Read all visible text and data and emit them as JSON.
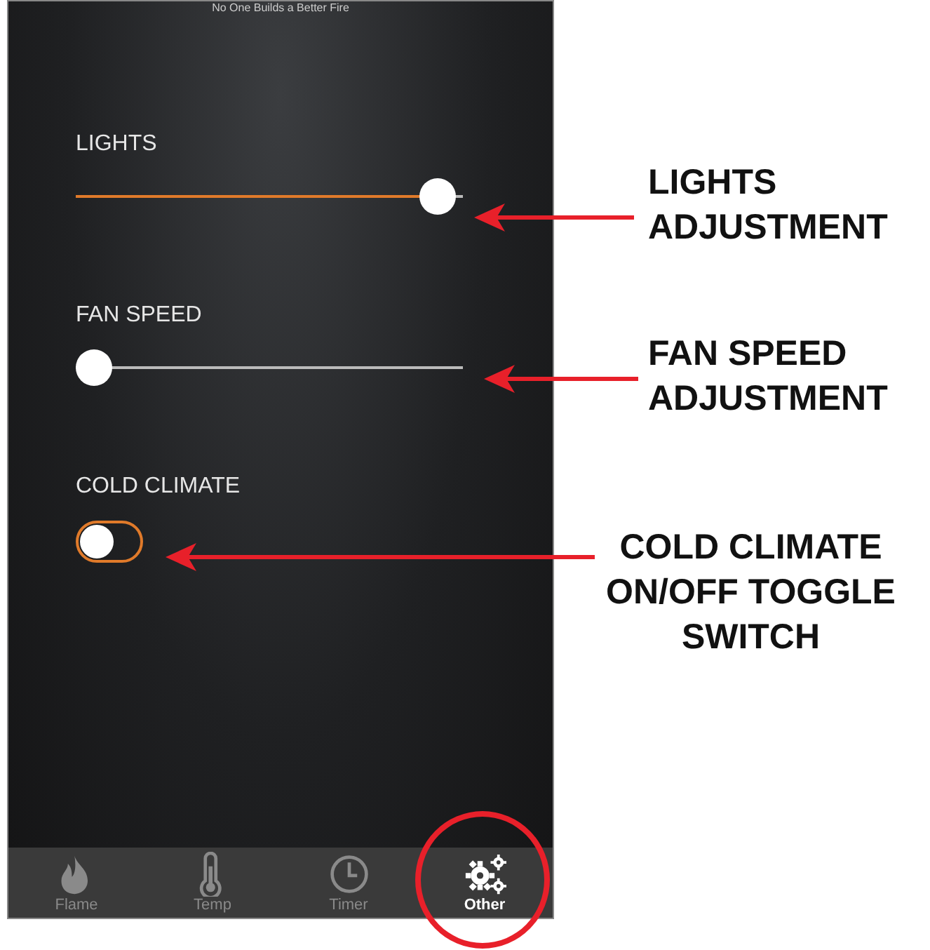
{
  "screen": {
    "tagline": "No One Builds a Better Fire",
    "settings": [
      {
        "kind": "slider",
        "label": "LIGHTS",
        "level": 0.98
      },
      {
        "kind": "slider",
        "label": "FAN SPEED",
        "level": 0
      },
      {
        "kind": "toggle",
        "label": "COLD CLIMATE",
        "on": false
      }
    ],
    "tabs": [
      {
        "label": "Flame",
        "selected": false,
        "circled": false
      },
      {
        "label": "Temp",
        "selected": false,
        "circled": false
      },
      {
        "label": "Timer",
        "selected": false,
        "circled": false
      },
      {
        "label": "Other",
        "selected": true,
        "circled": true
      }
    ]
  },
  "callouts": [
    {
      "lines": [
        "LIGHTS",
        "ADJUSTMENT"
      ]
    },
    {
      "lines": [
        "FAN SPEED",
        "ADJUSTMENT"
      ]
    },
    {
      "lines": [
        "COLD CLIMATE",
        "ON/OFF TOGGLE",
        "SWITCH"
      ]
    }
  ]
}
